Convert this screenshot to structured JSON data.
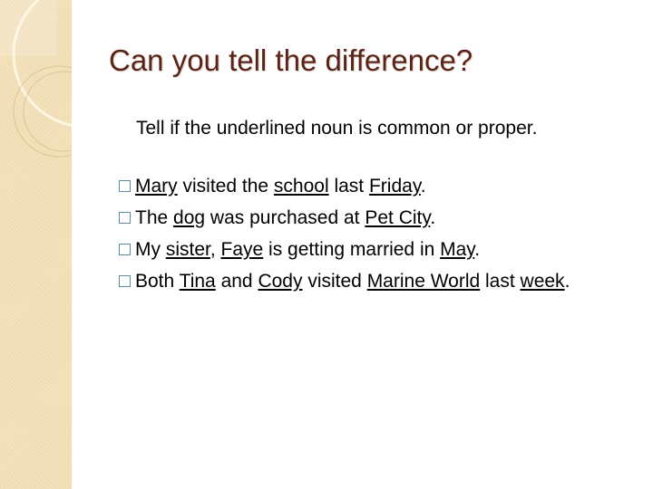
{
  "slide": {
    "title": "Can you tell the difference?",
    "instruction": "Tell if the underlined noun is common or proper.",
    "accent_colors": {
      "title": "#5a2418",
      "sidebar": "#f2dfb6",
      "bullet": "#5b8a9e"
    },
    "bullet_icon": "hollow-square",
    "items": [
      {
        "segments": [
          {
            "text": "Mary",
            "underlined": true
          },
          {
            "text": " visited the ",
            "underlined": false
          },
          {
            "text": "school",
            "underlined": true
          },
          {
            "text": " last ",
            "underlined": false
          },
          {
            "text": "Friday",
            "underlined": true
          },
          {
            "text": ".",
            "underlined": false
          }
        ]
      },
      {
        "segments": [
          {
            "text": "The ",
            "underlined": false
          },
          {
            "text": "dog",
            "underlined": true
          },
          {
            "text": " was purchased at ",
            "underlined": false
          },
          {
            "text": "Pet City",
            "underlined": true
          },
          {
            "text": ".",
            "underlined": false
          }
        ]
      },
      {
        "segments": [
          {
            "text": "My ",
            "underlined": false
          },
          {
            "text": "sister",
            "underlined": true
          },
          {
            "text": ", ",
            "underlined": false
          },
          {
            "text": "Faye",
            "underlined": true
          },
          {
            "text": " is getting married in ",
            "underlined": false
          },
          {
            "text": "May",
            "underlined": true
          },
          {
            "text": ".",
            "underlined": false
          }
        ]
      },
      {
        "segments": [
          {
            "text": "Both ",
            "underlined": false
          },
          {
            "text": "Tina",
            "underlined": true
          },
          {
            "text": " and ",
            "underlined": false
          },
          {
            "text": "Cody",
            "underlined": true
          },
          {
            "text": " visited ",
            "underlined": false
          },
          {
            "text": "Marine World",
            "underlined": true
          },
          {
            "text": " last ",
            "underlined": false
          },
          {
            "text": "week",
            "underlined": true
          },
          {
            "text": ".",
            "underlined": false
          }
        ]
      }
    ]
  }
}
